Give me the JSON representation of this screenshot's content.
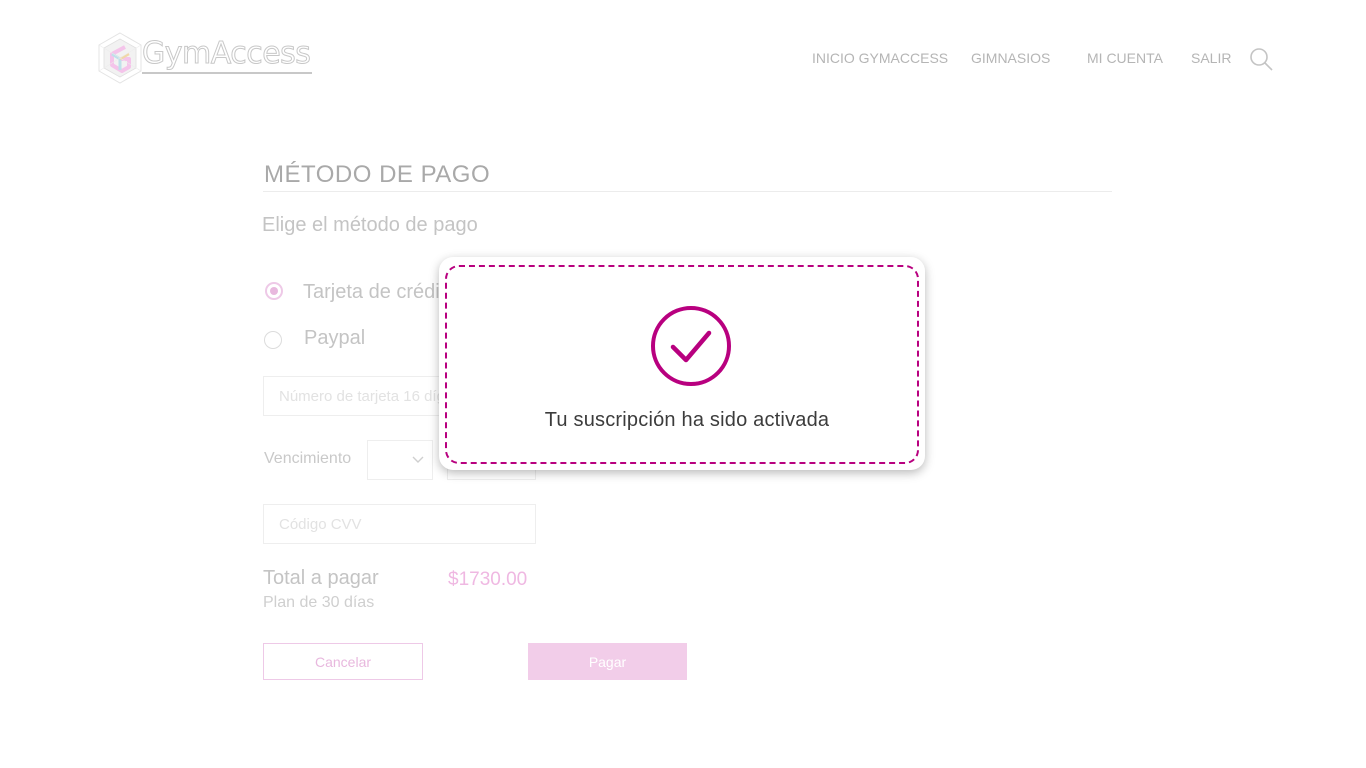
{
  "header": {
    "logo_text": "GymAccess",
    "nav": [
      {
        "label": "INICIO GYMACCESS"
      },
      {
        "label": "GIMNASIOS"
      },
      {
        "label": "MI CUENTA"
      },
      {
        "label": "SALIR"
      }
    ],
    "search_icon": "search-icon"
  },
  "payment": {
    "title": "MÉTODO DE PAGO",
    "subtitle": "Elige el método de pago",
    "methods": [
      {
        "label": "Tarjeta de crédito",
        "selected": true
      },
      {
        "label": "Paypal",
        "selected": false
      }
    ],
    "card_number_placeholder": "Número de tarjeta 16 dígitos",
    "expiration_label": "Vencimiento",
    "cvv_placeholder": "Código CVV",
    "total_label": "Total a pagar",
    "total_amount": "$1730.00",
    "plan_label": "Plan de 30 días",
    "cancel_label": "Cancelar",
    "pay_label": "Pagar"
  },
  "modal": {
    "message": "Tu suscripción ha sido activada",
    "icon": "check-circle-icon"
  },
  "colors": {
    "accent": "#b8007f",
    "accent_faded": "#f2cde9",
    "nav_text": "#b5b5b5"
  }
}
